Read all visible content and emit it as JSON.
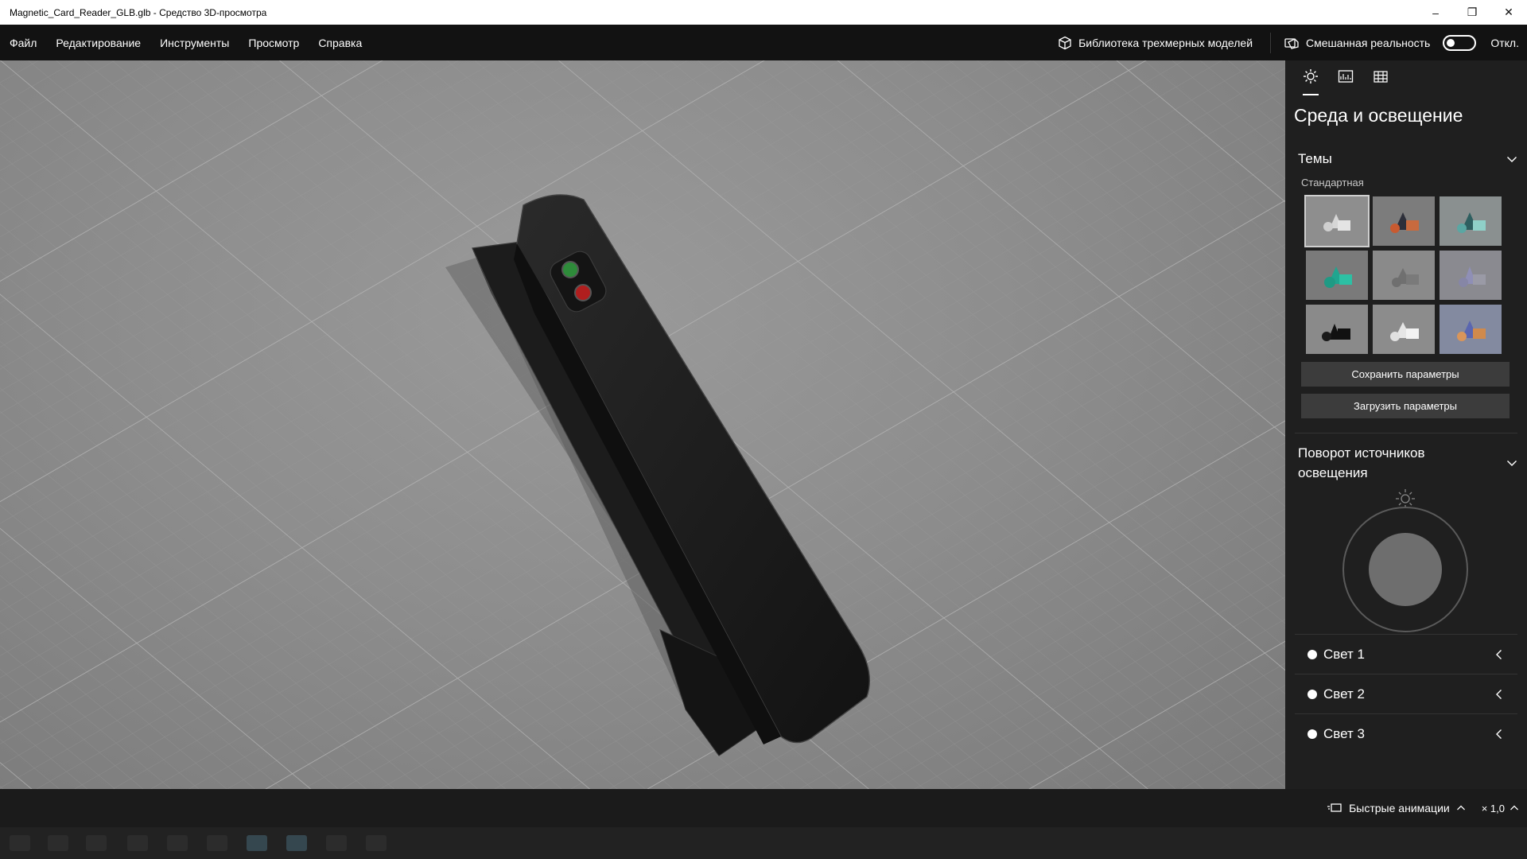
{
  "window": {
    "title": "Magnetic_Card_Reader_GLB.glb - Средство 3D-просмотра",
    "minimize_glyph": "–",
    "maximize_glyph": "❐",
    "close_glyph": "✕"
  },
  "menu": {
    "items": [
      "Файл",
      "Редактирование",
      "Инструменты",
      "Просмотр",
      "Справка"
    ],
    "library_label": "Библиотека трехмерных моделей",
    "mixed_reality_label": "Смешанная реальность",
    "toggle_state_label": "Откл."
  },
  "panel": {
    "tabs": [
      "sun-icon",
      "stats-icon",
      "grid-icon"
    ],
    "title": "Среда и освещение",
    "themes": {
      "label": "Темы",
      "subgroup": "Стандартная",
      "selected_index": 0
    },
    "save_label": "Сохранить параметры",
    "load_label": "Загрузить параметры",
    "rotation_label_line1": "Поворот источников",
    "rotation_label_line2": "освещения",
    "lights": [
      {
        "label": "Свет 1"
      },
      {
        "label": "Свет 2"
      },
      {
        "label": "Свет 3"
      }
    ]
  },
  "statusbar": {
    "animations_label": "Быстрые анимации",
    "speed_label": "× 1,0"
  },
  "colors": {
    "background": "#1b1b1b",
    "menubar": "#121212",
    "panel": "#1f1f1f",
    "button": "#3c3c3c",
    "viewport": "#8d8d8d",
    "model": "#1a1a1a",
    "led_green": "#2e8b3a",
    "led_red": "#b01e1e"
  }
}
